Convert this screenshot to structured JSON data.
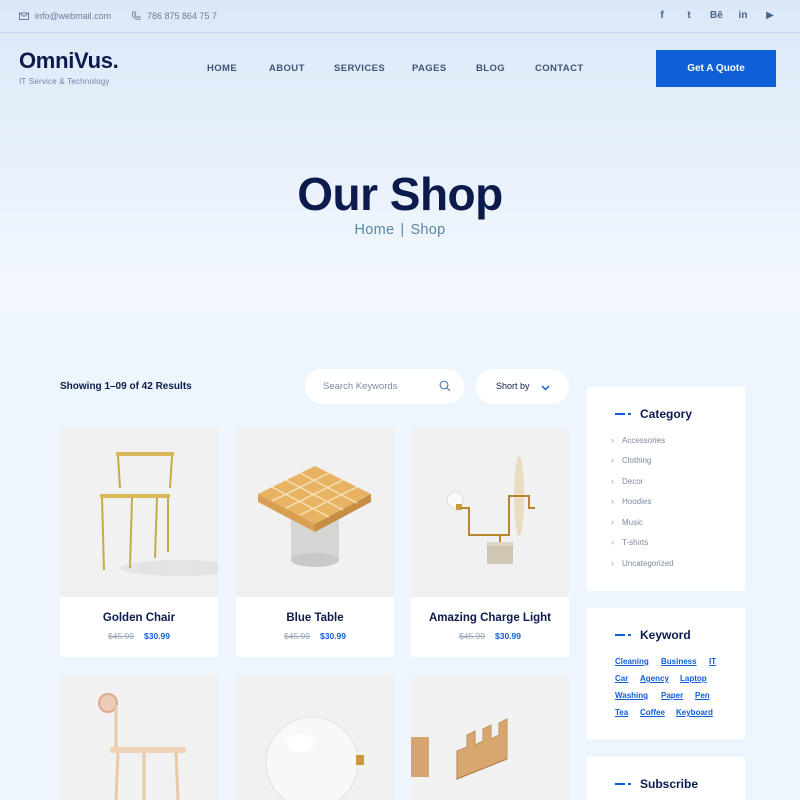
{
  "topbar": {
    "email": "info@webmail.com",
    "phone": "786 875 864 75 7",
    "email_icon": "mail-icon",
    "phone_icon": "phone-icon",
    "socials": [
      {
        "icon": "facebook-icon",
        "glyph": "f"
      },
      {
        "icon": "twitter-icon",
        "glyph": "t"
      },
      {
        "icon": "behance-icon",
        "glyph": "Bē"
      },
      {
        "icon": "linkedin-icon",
        "glyph": "in"
      },
      {
        "icon": "youtube-icon",
        "glyph": "▶"
      }
    ]
  },
  "header": {
    "logo_name": "OmniVus.",
    "logo_tagline": "IT Service & Technology",
    "nav": [
      "HOME",
      "ABOUT",
      "SERVICES",
      "PAGES",
      "BLOG",
      "CONTACT"
    ],
    "cta": "Get A Quote"
  },
  "hero": {
    "title": "Our Shop",
    "breadcrumb": [
      "Home",
      "|",
      "Shop"
    ]
  },
  "toolbar": {
    "showing": "Showing 1–09 of 42 Results",
    "search_placeholder": "Search Keywords",
    "sort_label": "Short by"
  },
  "products": [
    {
      "name": "Golden Chair",
      "old_price": "$45.99",
      "price": "$30.99"
    },
    {
      "name": "Blue Table",
      "old_price": "$45.99",
      "price": "$30.99"
    },
    {
      "name": "Amazing Charge Light",
      "old_price": "$45.99",
      "price": "$30.99"
    },
    {
      "name": "",
      "old_price": "",
      "price": ""
    },
    {
      "name": "",
      "old_price": "",
      "price": ""
    },
    {
      "name": "",
      "old_price": "",
      "price": ""
    }
  ],
  "sidebar": {
    "category_title": "Category",
    "categories": [
      "Accessories",
      "Clothing",
      "Decor",
      "Hoodies",
      "Music",
      "T-shirts",
      "Uncategorized"
    ],
    "keyword_title": "Keyword",
    "keywords": [
      "Cleaning",
      "Business",
      "IT",
      "Car",
      "Agency",
      "Laptop",
      "Washing",
      "Paper",
      "Pen",
      "Tea",
      "Coffee",
      "Keyboard"
    ],
    "subscribe_title": "Subscribe"
  },
  "colors": {
    "accent": "#0f5fd9",
    "heading": "#0d1b4c",
    "page_bg": "#eef6fd"
  }
}
